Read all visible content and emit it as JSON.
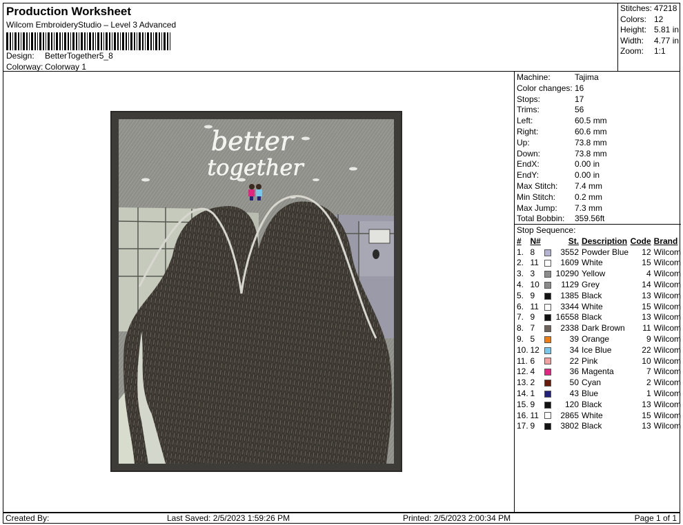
{
  "header": {
    "title": "Production Worksheet",
    "subtitle": "Wilcom EmbroideryStudio – Level 3 Advanced",
    "design_label": "Design:",
    "design_value": "BetterTogether5_8",
    "colorway_label": "Colorway:",
    "colorway_value": "Colorway 1"
  },
  "summary": [
    {
      "label": "Stitches:",
      "value": "47218"
    },
    {
      "label": "Colors:",
      "value": "12"
    },
    {
      "label": "Height:",
      "value": "5.81 in"
    },
    {
      "label": "Width:",
      "value": "4.77 in"
    },
    {
      "label": "Zoom:",
      "value": "1:1"
    }
  ],
  "machine": [
    {
      "label": "Machine:",
      "value": "Tajima"
    },
    {
      "label": "Color changes:",
      "value": "16"
    },
    {
      "label": "Stops:",
      "value": "17"
    },
    {
      "label": "Trims:",
      "value": "56"
    },
    {
      "label": "Left:",
      "value": "60.5 mm"
    },
    {
      "label": "Right:",
      "value": "60.6 mm"
    },
    {
      "label": "Up:",
      "value": "73.8 mm"
    },
    {
      "label": "Down:",
      "value": "73.8 mm"
    },
    {
      "label": "EndX:",
      "value": "0.00 in"
    },
    {
      "label": "EndY:",
      "value": "0.00 in"
    },
    {
      "label": "Max Stitch:",
      "value": "7.4 mm"
    },
    {
      "label": "Min Stitch:",
      "value": "0.2 mm"
    },
    {
      "label": "Max Jump:",
      "value": "7.3 mm"
    },
    {
      "label": "Total Bobbin:",
      "value": "359.56ft"
    }
  ],
  "stops": {
    "title": "Stop Sequence:",
    "headers": {
      "num": "#",
      "n": "N#",
      "st": "St.",
      "desc": "Description",
      "code": "Code",
      "brand": "Brand"
    },
    "rows": [
      {
        "num": "1.",
        "n": "8",
        "color": "#b4b4d2",
        "st": "3552",
        "desc": "Powder Blue",
        "code": "12",
        "brand": "Wilcom"
      },
      {
        "num": "2.",
        "n": "11",
        "color": "#ffffff",
        "st": "1609",
        "desc": "White",
        "code": "15",
        "brand": "Wilcom"
      },
      {
        "num": "3.",
        "n": "3",
        "color": "#8c8c8c",
        "st": "10290",
        "desc": "Yellow",
        "code": "4",
        "brand": "Wilcom"
      },
      {
        "num": "4.",
        "n": "10",
        "color": "#8a8a8a",
        "st": "1129",
        "desc": "Grey",
        "code": "14",
        "brand": "Wilcom"
      },
      {
        "num": "5.",
        "n": "9",
        "color": "#111111",
        "st": "1385",
        "desc": "Black",
        "code": "13",
        "brand": "Wilcom"
      },
      {
        "num": "6.",
        "n": "11",
        "color": "#ffffff",
        "st": "3344",
        "desc": "White",
        "code": "15",
        "brand": "Wilcom"
      },
      {
        "num": "7.",
        "n": "9",
        "color": "#111111",
        "st": "16558",
        "desc": "Black",
        "code": "13",
        "brand": "Wilcom"
      },
      {
        "num": "8.",
        "n": "7",
        "color": "#6e645c",
        "st": "2338",
        "desc": "Dark Brown",
        "code": "11",
        "brand": "Wilcom"
      },
      {
        "num": "9.",
        "n": "5",
        "color": "#f07c14",
        "st": "39",
        "desc": "Orange",
        "code": "9",
        "brand": "Wilcom"
      },
      {
        "num": "10.",
        "n": "12",
        "color": "#78c8ec",
        "st": "34",
        "desc": "Ice Blue",
        "code": "22",
        "brand": "Wilcom"
      },
      {
        "num": "11.",
        "n": "6",
        "color": "#f2a0a0",
        "st": "22",
        "desc": "Pink",
        "code": "10",
        "brand": "Wilcom"
      },
      {
        "num": "12.",
        "n": "4",
        "color": "#e0267e",
        "st": "36",
        "desc": "Magenta",
        "code": "7",
        "brand": "Wilcom"
      },
      {
        "num": "13.",
        "n": "2",
        "color": "#6a1a0a",
        "st": "50",
        "desc": "Cyan",
        "code": "2",
        "brand": "Wilcom"
      },
      {
        "num": "14.",
        "n": "1",
        "color": "#22207a",
        "st": "43",
        "desc": "Blue",
        "code": "1",
        "brand": "Wilcom"
      },
      {
        "num": "15.",
        "n": "9",
        "color": "#111111",
        "st": "120",
        "desc": "Black",
        "code": "13",
        "brand": "Wilcom"
      },
      {
        "num": "16.",
        "n": "11",
        "color": "#ffffff",
        "st": "2865",
        "desc": "White",
        "code": "15",
        "brand": "Wilcom"
      },
      {
        "num": "17.",
        "n": "9",
        "color": "#111111",
        "st": "3802",
        "desc": "Black",
        "code": "13",
        "brand": "Wilcom"
      }
    ]
  },
  "design": {
    "text_line1": "better",
    "text_line2": "together",
    "frame_color": "#3e3c38",
    "sky_color": "#8f8f89",
    "hair_color": "#3a3630"
  },
  "footer": {
    "created": "Created By:",
    "saved": "Last Saved: 2/5/2023 1:59:26 PM",
    "printed": "Printed: 2/5/2023 2:00:34 PM",
    "page": "Page 1 of 1"
  }
}
